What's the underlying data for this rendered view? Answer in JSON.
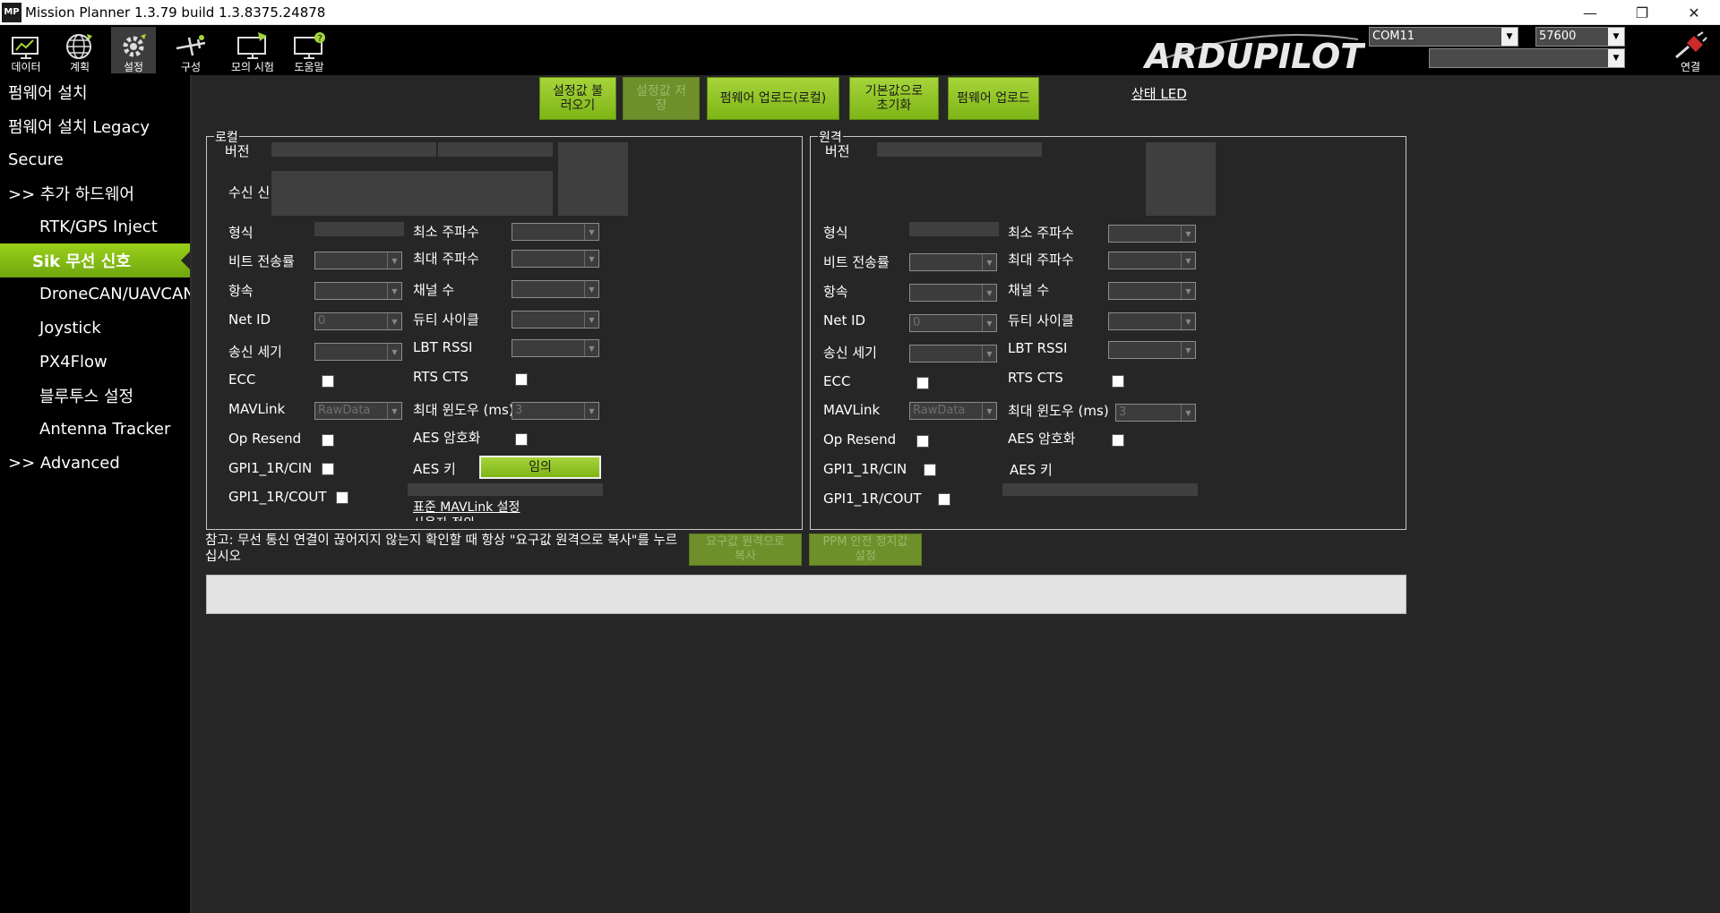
{
  "window": {
    "title": "Mission Planner 1.3.79 build 1.3.8375.24878",
    "app_icon": "MP",
    "minimize": "—",
    "restore": "❐",
    "close": "✕"
  },
  "toolbar": {
    "items": [
      {
        "label": "데이터",
        "icon": "data-monitor-icon"
      },
      {
        "label": "계획",
        "icon": "globe-plan-icon"
      },
      {
        "label": "설정",
        "icon": "gear-setup-icon",
        "active": true
      },
      {
        "label": "구성",
        "icon": "plane-config-icon"
      },
      {
        "label": "모의 시험",
        "icon": "sim-monitor-icon"
      },
      {
        "label": "도움말",
        "icon": "help-monitor-icon"
      }
    ],
    "logo_text": "ARDUPILOT",
    "port": "COM11",
    "baud": "57600",
    "extra_combo": "",
    "connect_label": "연결"
  },
  "sidebar": {
    "items": [
      {
        "label": "펌웨어 설치",
        "level": 0
      },
      {
        "label": "펌웨어 설치 Legacy",
        "level": 0
      },
      {
        "label": "Secure",
        "level": 0
      },
      {
        "label": ">> 추가 하드웨어",
        "level": 0
      },
      {
        "label": "RTK/GPS Inject",
        "level": 1
      },
      {
        "label": "Sik 무선 신호",
        "level": 1,
        "active": true
      },
      {
        "label": "DroneCAN/UAVCAN",
        "level": 1
      },
      {
        "label": "Joystick",
        "level": 1
      },
      {
        "label": "PX4Flow",
        "level": 1
      },
      {
        "label": "블루투스 설정",
        "level": 1
      },
      {
        "label": "Antenna Tracker",
        "level": 1
      },
      {
        "label": ">> Advanced",
        "level": 0
      }
    ]
  },
  "top_buttons": {
    "load": "설정값 불\n러오기",
    "save": "설정값 저\n장",
    "upload_local": "펌웨어 업로드(로컬)",
    "reset_default": "기본값으로\n초기화",
    "upload_fw": "펌웨어 업로드",
    "status_led": "상태 LED"
  },
  "local": {
    "title": "로컬",
    "version": "버전",
    "rssi": "수신 신",
    "format": "형식",
    "baud": "비트 전송률",
    "airspeed": "항속",
    "netid": "Net ID",
    "netid_value": "0",
    "txpower": "송신 세기",
    "ecc": "ECC",
    "mavlink": "MAVLink",
    "mavlink_value": "RawData",
    "opresend": "Op Resend",
    "gpi1": "GPI1_1R/CIN",
    "gpo1": "GPI1_1R/COUT",
    "minfreq": "최소 주파수",
    "maxfreq": "최대 주파수",
    "channels": "채널 수",
    "duty": "듀티 사이클",
    "lbt": "LBT RSSI",
    "rtscts": "RTS CTS",
    "maxwindow": "최대 윈도우 (ms)",
    "maxwindow_value": "3",
    "aes": "AES 암호화",
    "aeskey": "AES 키",
    "random_btn": "임의",
    "std_link": "표준 MAVLink 설정",
    "extra_link": "사용자 정의"
  },
  "remote": {
    "title": "원격",
    "version": "버전",
    "format": "형식",
    "baud": "비트 전송률",
    "airspeed": "항속",
    "netid": "Net ID",
    "netid_value": "0",
    "txpower": "송신 세기",
    "ecc": "ECC",
    "mavlink": "MAVLink",
    "mavlink_value": "RawData",
    "opresend": "Op Resend",
    "gpi1": "GPI1_1R/CIN",
    "gpo1": "GPI1_1R/COUT",
    "minfreq": "최소 주파수",
    "maxfreq": "최대 주파수",
    "channels": "채널 수",
    "duty": "듀티 사이클",
    "lbt": "LBT RSSI",
    "rtscts": "RTS CTS",
    "maxwindow": "최대 윈도우 (ms)",
    "maxwindow_value": "3",
    "aes": "AES 암호화",
    "aeskey": "AES 키"
  },
  "bottom": {
    "note": "참고: 무선 통신 연결이 끊어지지 않는지 확인할 때 항상 \"요구값 원격으로 복사\"를 누르십시오",
    "copy_remote": "요구값 원격으로\n복사",
    "ppm_failsafe": "PPM 안전 정지값\n설정"
  }
}
